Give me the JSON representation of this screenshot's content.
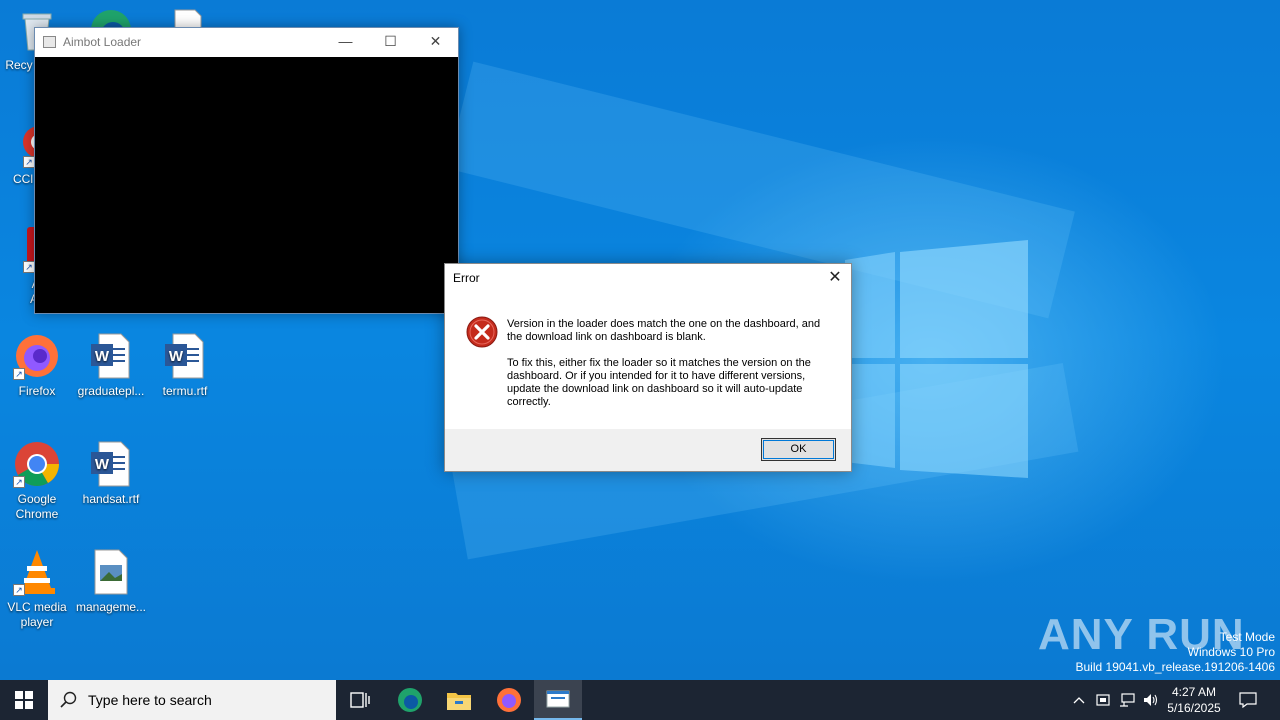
{
  "desktop": {
    "icons": [
      {
        "label": "Recy",
        "icon": "recycle-bin-icon"
      },
      {
        "label": "CCl",
        "icon": "ccleaner-icon"
      },
      {
        "label": "Ad Acr",
        "icon": "acrobat-icon"
      },
      {
        "label": "Firefox",
        "icon": "firefox-icon"
      },
      {
        "label": "graduatepl...",
        "icon": "word-doc-icon"
      },
      {
        "label": "termu.rtf",
        "icon": "word-doc-icon"
      },
      {
        "label": "Google Chrome",
        "icon": "chrome-icon"
      },
      {
        "label": "handsat.rtf",
        "icon": "word-doc-icon"
      },
      {
        "label": "VLC media player",
        "icon": "vlc-icon"
      },
      {
        "label": "manageme...",
        "icon": "image-file-icon"
      }
    ]
  },
  "loader_window": {
    "title": "Aimbot Loader",
    "minimize": "—",
    "maximize": "☐",
    "close": "✕"
  },
  "error_dialog": {
    "title": "Error",
    "close": "✕",
    "message_1": "Version in the loader does match the one on the dashboard, and the download link on dashboard is blank.",
    "message_2": "To fix this, either fix the loader so it matches the version on the dashboard. Or if you intended for it to have different versions, update the download link on dashboard so it will auto-update correctly.",
    "ok_label": "OK"
  },
  "watermark": {
    "brand": "ANY RUN",
    "line1": "Test Mode",
    "line2": "Windows 10 Pro",
    "line3": "Build 19041.vb_release.191206-1406"
  },
  "taskbar": {
    "search_placeholder": "Type here to search",
    "time": "4:27 AM",
    "date": "5/16/2025",
    "apps": [
      "start-icon",
      "task-view-icon",
      "edge-icon",
      "file-explorer-icon",
      "firefox-icon",
      "console-app-icon"
    ]
  },
  "colors": {
    "desktop": "#0a86e0",
    "taskbar": "#1c2533",
    "accent": "#0078d7",
    "error_red": "#c42b1c"
  }
}
